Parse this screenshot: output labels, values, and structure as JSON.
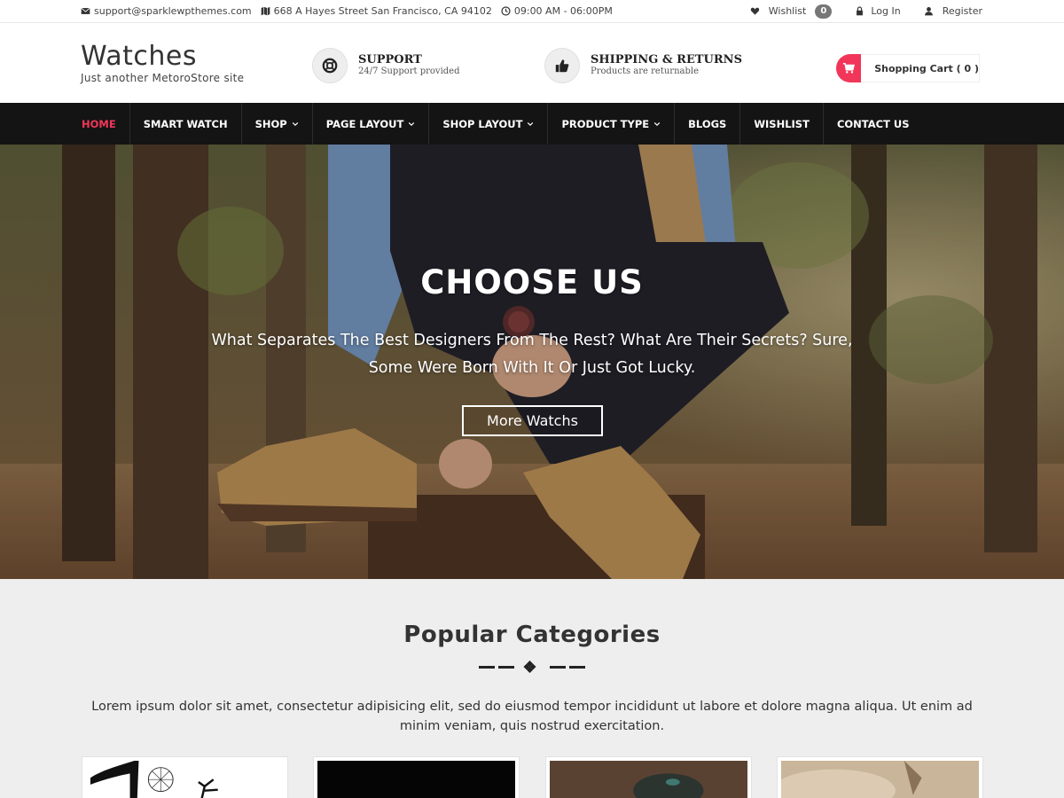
{
  "topbar": {
    "email": "support@sparklewpthemes.com",
    "address": "668 A Hayes Street San Francisco, CA 94102",
    "hours": "09:00 AM - 06:00PM",
    "wishlist_label": "Wishlist",
    "wishlist_count": "0",
    "login_label": "Log In",
    "register_label": "Register"
  },
  "header": {
    "site_title": "Watches",
    "tagline": "Just another MetoroStore site",
    "support_title": "SUPPORT",
    "support_sub": "24/7 Support provided",
    "shipping_title": "SHIPPING & RETURNS",
    "shipping_sub": "Products are returnable",
    "cart_label": "Shopping Cart ( 0 )"
  },
  "nav": {
    "items": [
      {
        "label": "Home",
        "active": true
      },
      {
        "label": "Smart Watch"
      },
      {
        "label": "Shop",
        "dropdown": true
      },
      {
        "label": "Page Layout",
        "dropdown": true
      },
      {
        "label": "Shop Layout",
        "dropdown": true
      },
      {
        "label": "Product Type",
        "dropdown": true
      },
      {
        "label": "Blogs"
      },
      {
        "label": "Wishlist"
      },
      {
        "label": "Contact Us"
      }
    ]
  },
  "hero": {
    "title": "CHOOSE US",
    "subtitle": "What Separates The Best Designers From The Rest? What Are Their Secrets? Sure, Some Were Born With It Or Just Got Lucky.",
    "button_label": "More Watchs"
  },
  "popular": {
    "title": "Popular Categories",
    "text": "Lorem ipsum dolor sit amet, consectetur adipisicing elit, sed do eiusmod tempor incididunt ut labore et dolore magna aliqua. Ut enim ad minim veniam, quis nostrud exercitation."
  },
  "colors": {
    "accent": "#f1365a",
    "nav_bg": "#141414",
    "section_bg": "#eeeeee"
  },
  "icons": {
    "email": "envelope-icon",
    "address": "map-icon",
    "hours": "clock-icon",
    "wishlist": "heart-icon",
    "login": "lock-icon",
    "register": "user-icon",
    "support": "lifebuoy-icon",
    "shipping": "thumbs-up-icon",
    "cart": "cart-icon",
    "dropdown": "chevron-down-icon"
  }
}
